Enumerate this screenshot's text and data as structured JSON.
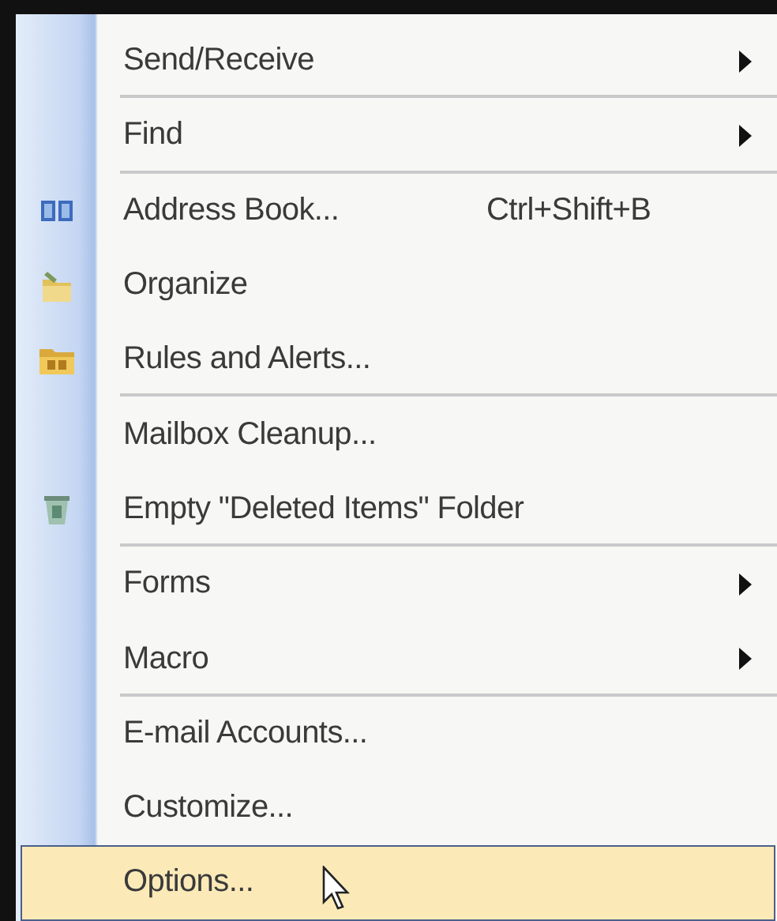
{
  "menu": {
    "items": [
      {
        "label": "Send/Receive",
        "submenu": true,
        "separator_after": true,
        "selected": false
      },
      {
        "label": "Find",
        "submenu": true,
        "separator_after": true,
        "selected": false
      },
      {
        "label": "Address Book...",
        "shortcut": "Ctrl+Shift+B",
        "submenu": false,
        "separator_after": false,
        "selected": false
      },
      {
        "label": "Organize",
        "submenu": false,
        "separator_after": false,
        "selected": false
      },
      {
        "label": "Rules and Alerts...",
        "submenu": false,
        "separator_after": true,
        "selected": false
      },
      {
        "label": "Mailbox Cleanup...",
        "submenu": false,
        "separator_after": false,
        "selected": false
      },
      {
        "label": "Empty \"Deleted Items\" Folder",
        "submenu": false,
        "separator_after": true,
        "selected": false
      },
      {
        "label": "Forms",
        "submenu": true,
        "separator_after": false,
        "selected": false
      },
      {
        "label": "Macro",
        "submenu": true,
        "separator_after": true,
        "selected": false
      },
      {
        "label": "E-mail Accounts...",
        "submenu": false,
        "separator_after": false,
        "selected": false
      },
      {
        "label": "Customize...",
        "submenu": false,
        "separator_after": false,
        "selected": false
      },
      {
        "label": "Options...",
        "submenu": false,
        "separator_after": false,
        "selected": true
      }
    ]
  }
}
